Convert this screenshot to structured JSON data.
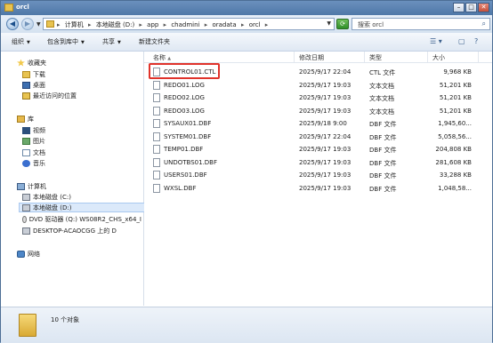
{
  "window": {
    "title": "orcl"
  },
  "address": {
    "crumbs": [
      "计算机",
      "本地磁盘 (D:)",
      "app",
      "chadmini",
      "oradata",
      "orcl"
    ]
  },
  "search": {
    "placeholder": "搜索 orcl"
  },
  "toolbar": {
    "organize": "组织",
    "include_in_library": "包含到库中",
    "share": "共享",
    "new_folder": "新建文件夹"
  },
  "nav": {
    "favorites": "收藏夹",
    "downloads": "下载",
    "desktop": "桌面",
    "recent": "最近访问的位置",
    "libraries": "库",
    "videos": "视频",
    "pictures": "图片",
    "documents": "文档",
    "music": "音乐",
    "computer": "计算机",
    "drive_c": "本地磁盘 (C:)",
    "drive_d": "本地磁盘 (D:)",
    "dvd": "DVD 驱动器 (Q:) WS08R2_CHS_x64_I",
    "desktop_drive": "DESKTOP-ACAOCGG 上的 D",
    "network": "网络"
  },
  "columns": {
    "name": "名称",
    "date": "修改日期",
    "type": "类型",
    "size": "大小"
  },
  "files": [
    {
      "name": "CONTROL01.CTL",
      "date": "2025/9/17 22:04",
      "type": "CTL 文件",
      "size": "9,968 KB"
    },
    {
      "name": "REDO01.LOG",
      "date": "2025/9/17 19:03",
      "type": "文本文档",
      "size": "51,201 KB"
    },
    {
      "name": "REDO02.LOG",
      "date": "2025/9/17 19:03",
      "type": "文本文档",
      "size": "51,201 KB"
    },
    {
      "name": "REDO03.LOG",
      "date": "2025/9/17 19:03",
      "type": "文本文档",
      "size": "51,201 KB"
    },
    {
      "name": "SYSAUX01.DBF",
      "date": "2025/9/18 9:00",
      "type": "DBF 文件",
      "size": "1,945,60..."
    },
    {
      "name": "SYSTEM01.DBF",
      "date": "2025/9/17 22:04",
      "type": "DBF 文件",
      "size": "5,058,56..."
    },
    {
      "name": "TEMP01.DBF",
      "date": "2025/9/17 19:03",
      "type": "DBF 文件",
      "size": "204,808 KB"
    },
    {
      "name": "UNDOTBS01.DBF",
      "date": "2025/9/17 19:03",
      "type": "DBF 文件",
      "size": "281,608 KB"
    },
    {
      "name": "USERS01.DBF",
      "date": "2025/9/17 19:03",
      "type": "DBF 文件",
      "size": "33,288 KB"
    },
    {
      "name": "WXSL.DBF",
      "date": "2025/9/17 19:03",
      "type": "DBF 文件",
      "size": "1,048,58..."
    }
  ],
  "status": {
    "count": "10 个对象"
  }
}
